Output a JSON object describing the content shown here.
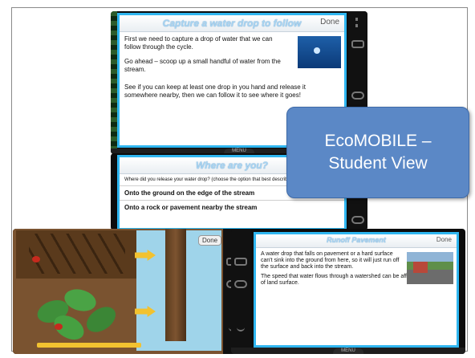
{
  "screen1": {
    "title": "Capture a water drop to follow",
    "done": "Done",
    "p1": "First we need to capture a drop of water that we can follow through the cycle.",
    "p2": "Go ahead – scoop up a small handful of water from the stream.",
    "p3": "See if you can keep at least one drop in you hand and release it somewhere nearby, then we can follow it to see where it goes!",
    "menu": "MENU"
  },
  "screen2": {
    "title": "Where are you?",
    "question": "Where did you release your water drop? (choose the option that best describes your location)",
    "options": [
      "Onto the ground on the edge of the stream",
      "Onto a rock or pavement nearby the stream"
    ]
  },
  "screen3": {
    "done": "Done"
  },
  "screen4": {
    "title": "Runoff Pavement",
    "done": "Done",
    "p1": "A water drop that falls on pavement or a hard surface can't sink into the ground from here, so it will just run off the surface and back into the stream.",
    "p2": "The speed that water flows through a watershed can be affected by the type of land surface.",
    "menu": "MENU"
  },
  "callout": {
    "line1": "EcoMOBILE –",
    "line2": "Student View",
    "color": "#5b88c6"
  }
}
